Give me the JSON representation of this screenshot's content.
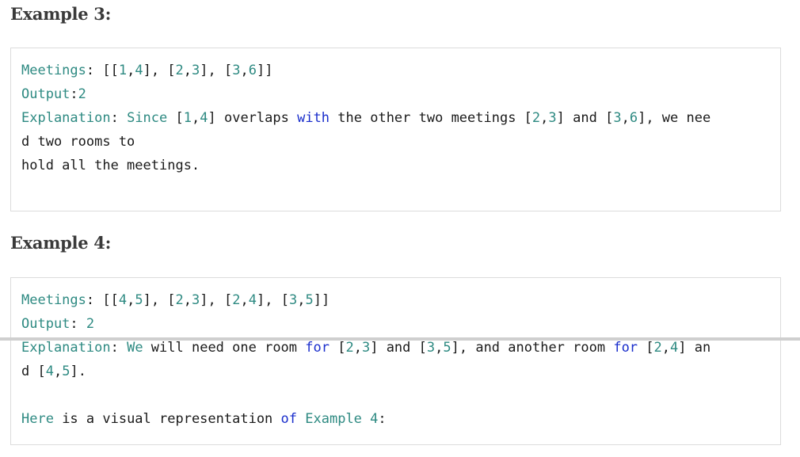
{
  "example3": {
    "heading": "Example 3:",
    "lines": [
      [
        {
          "text": "Meetings",
          "c": "t"
        },
        {
          "text": ": [[",
          "c": "p"
        },
        {
          "text": "1",
          "c": "n"
        },
        {
          "text": ",",
          "c": "p"
        },
        {
          "text": "4",
          "c": "n"
        },
        {
          "text": "], [",
          "c": "p"
        },
        {
          "text": "2",
          "c": "n"
        },
        {
          "text": ",",
          "c": "p"
        },
        {
          "text": "3",
          "c": "n"
        },
        {
          "text": "], [",
          "c": "p"
        },
        {
          "text": "3",
          "c": "n"
        },
        {
          "text": ",",
          "c": "p"
        },
        {
          "text": "6",
          "c": "n"
        },
        {
          "text": "]]",
          "c": "p"
        }
      ],
      [
        {
          "text": "Output",
          "c": "t"
        },
        {
          "text": ":",
          "c": "p"
        },
        {
          "text": "2",
          "c": "n"
        }
      ],
      [
        {
          "text": "Explanation",
          "c": "t"
        },
        {
          "text": ": ",
          "c": "p"
        },
        {
          "text": "Since",
          "c": "t"
        },
        {
          "text": " [",
          "c": "p"
        },
        {
          "text": "1",
          "c": "n"
        },
        {
          "text": ",",
          "c": "p"
        },
        {
          "text": "4",
          "c": "n"
        },
        {
          "text": "] overlaps ",
          "c": "p"
        },
        {
          "text": "with",
          "c": "k"
        },
        {
          "text": " the other two meetings [",
          "c": "p"
        },
        {
          "text": "2",
          "c": "n"
        },
        {
          "text": ",",
          "c": "p"
        },
        {
          "text": "3",
          "c": "n"
        },
        {
          "text": "] and [",
          "c": "p"
        },
        {
          "text": "3",
          "c": "n"
        },
        {
          "text": ",",
          "c": "p"
        },
        {
          "text": "6",
          "c": "n"
        },
        {
          "text": "], we nee",
          "c": "p"
        }
      ],
      [
        {
          "text": "d two rooms to",
          "c": "p"
        }
      ],
      [
        {
          "text": "hold all the meetings.",
          "c": "p"
        }
      ]
    ]
  },
  "example4": {
    "heading": "Example 4:",
    "lines": [
      [
        {
          "text": "Meetings",
          "c": "t"
        },
        {
          "text": ": [[",
          "c": "p"
        },
        {
          "text": "4",
          "c": "n"
        },
        {
          "text": ",",
          "c": "p"
        },
        {
          "text": "5",
          "c": "n"
        },
        {
          "text": "], [",
          "c": "p"
        },
        {
          "text": "2",
          "c": "n"
        },
        {
          "text": ",",
          "c": "p"
        },
        {
          "text": "3",
          "c": "n"
        },
        {
          "text": "], [",
          "c": "p"
        },
        {
          "text": "2",
          "c": "n"
        },
        {
          "text": ",",
          "c": "p"
        },
        {
          "text": "4",
          "c": "n"
        },
        {
          "text": "], [",
          "c": "p"
        },
        {
          "text": "3",
          "c": "n"
        },
        {
          "text": ",",
          "c": "p"
        },
        {
          "text": "5",
          "c": "n"
        },
        {
          "text": "]]",
          "c": "p"
        }
      ],
      [
        {
          "text": "Output",
          "c": "t"
        },
        {
          "text": ": ",
          "c": "p"
        },
        {
          "text": "2",
          "c": "n"
        }
      ],
      [
        {
          "text": "Explanation",
          "c": "t"
        },
        {
          "text": ": ",
          "c": "p"
        },
        {
          "text": "We",
          "c": "t"
        },
        {
          "text": " will need one room ",
          "c": "p"
        },
        {
          "text": "for",
          "c": "k"
        },
        {
          "text": " [",
          "c": "p"
        },
        {
          "text": "2",
          "c": "n"
        },
        {
          "text": ",",
          "c": "p"
        },
        {
          "text": "3",
          "c": "n"
        },
        {
          "text": "] and [",
          "c": "p"
        },
        {
          "text": "3",
          "c": "n"
        },
        {
          "text": ",",
          "c": "p"
        },
        {
          "text": "5",
          "c": "n"
        },
        {
          "text": "], and another room ",
          "c": "p"
        },
        {
          "text": "for",
          "c": "k"
        },
        {
          "text": " [",
          "c": "p"
        },
        {
          "text": "2",
          "c": "n"
        },
        {
          "text": ",",
          "c": "p"
        },
        {
          "text": "4",
          "c": "n"
        },
        {
          "text": "] an",
          "c": "p"
        }
      ],
      [
        {
          "text": "d [",
          "c": "p"
        },
        {
          "text": "4",
          "c": "n"
        },
        {
          "text": ",",
          "c": "p"
        },
        {
          "text": "5",
          "c": "n"
        },
        {
          "text": "].",
          "c": "p"
        }
      ],
      [],
      [
        {
          "text": "Here",
          "c": "t"
        },
        {
          "text": " is a visual representation ",
          "c": "p"
        },
        {
          "text": "of",
          "c": "k"
        },
        {
          "text": " ",
          "c": "p"
        },
        {
          "text": "Example",
          "c": "t"
        },
        {
          "text": " ",
          "c": "p"
        },
        {
          "text": "4",
          "c": "n"
        },
        {
          "text": ":",
          "c": "p"
        }
      ]
    ]
  },
  "colors": {
    "heading": "#3a3a3a",
    "teal": "#2e8a82",
    "blue_keyword": "#1a2ecc",
    "plain": "#1a1a1a",
    "box_border": "#dcdcdc",
    "divider": "#cfcfcf"
  }
}
